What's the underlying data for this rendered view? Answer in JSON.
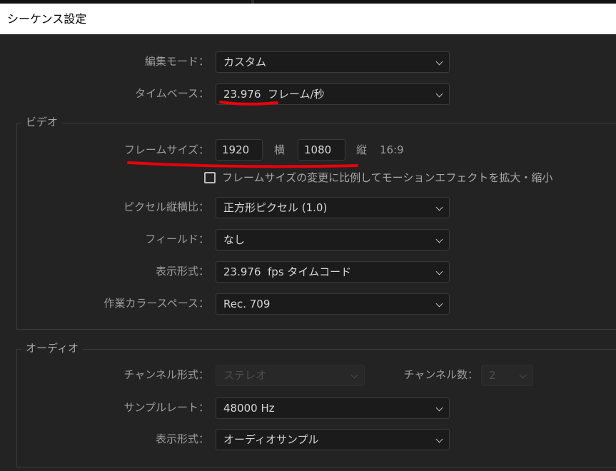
{
  "window": {
    "title": "シーケンス設定"
  },
  "general": {
    "edit_mode_label": "編集モード：",
    "edit_mode_value": "カスタム",
    "timebase_label": "タイムベース：",
    "timebase_value": "23.976  フレーム/秒"
  },
  "video": {
    "group_title": "ビデオ",
    "frame_size_label": "フレームサイズ：",
    "frame_width": "1920",
    "horizontal_unit": "横",
    "frame_height": "1080",
    "vertical_unit": "縦",
    "aspect_ratio": "16:9",
    "scale_checkbox_label": "フレームサイズの変更に比例してモーションエフェクトを拡大・縮小",
    "scale_checkbox_checked": false,
    "pixel_aspect_label": "ピクセル縦横比：",
    "pixel_aspect_value": "正方形ピクセル (1.0)",
    "fields_label": "フィールド：",
    "fields_value": "なし",
    "display_format_label": "表示形式：",
    "display_format_value": "23.976  fps タイムコード",
    "color_space_label": "作業カラースペース：",
    "color_space_value": "Rec. 709"
  },
  "audio": {
    "group_title": "オーディオ",
    "channel_format_label": "チャンネル形式：",
    "channel_format_value": "ステレオ",
    "channel_count_label": "チャンネル数：",
    "channel_count_value": "2",
    "sample_rate_label": "サンプルレート：",
    "sample_rate_value": "48000 Hz",
    "display_format_label": "表示形式：",
    "display_format_value": "オーディオサンプル"
  },
  "annotation_color": "#e8000b"
}
